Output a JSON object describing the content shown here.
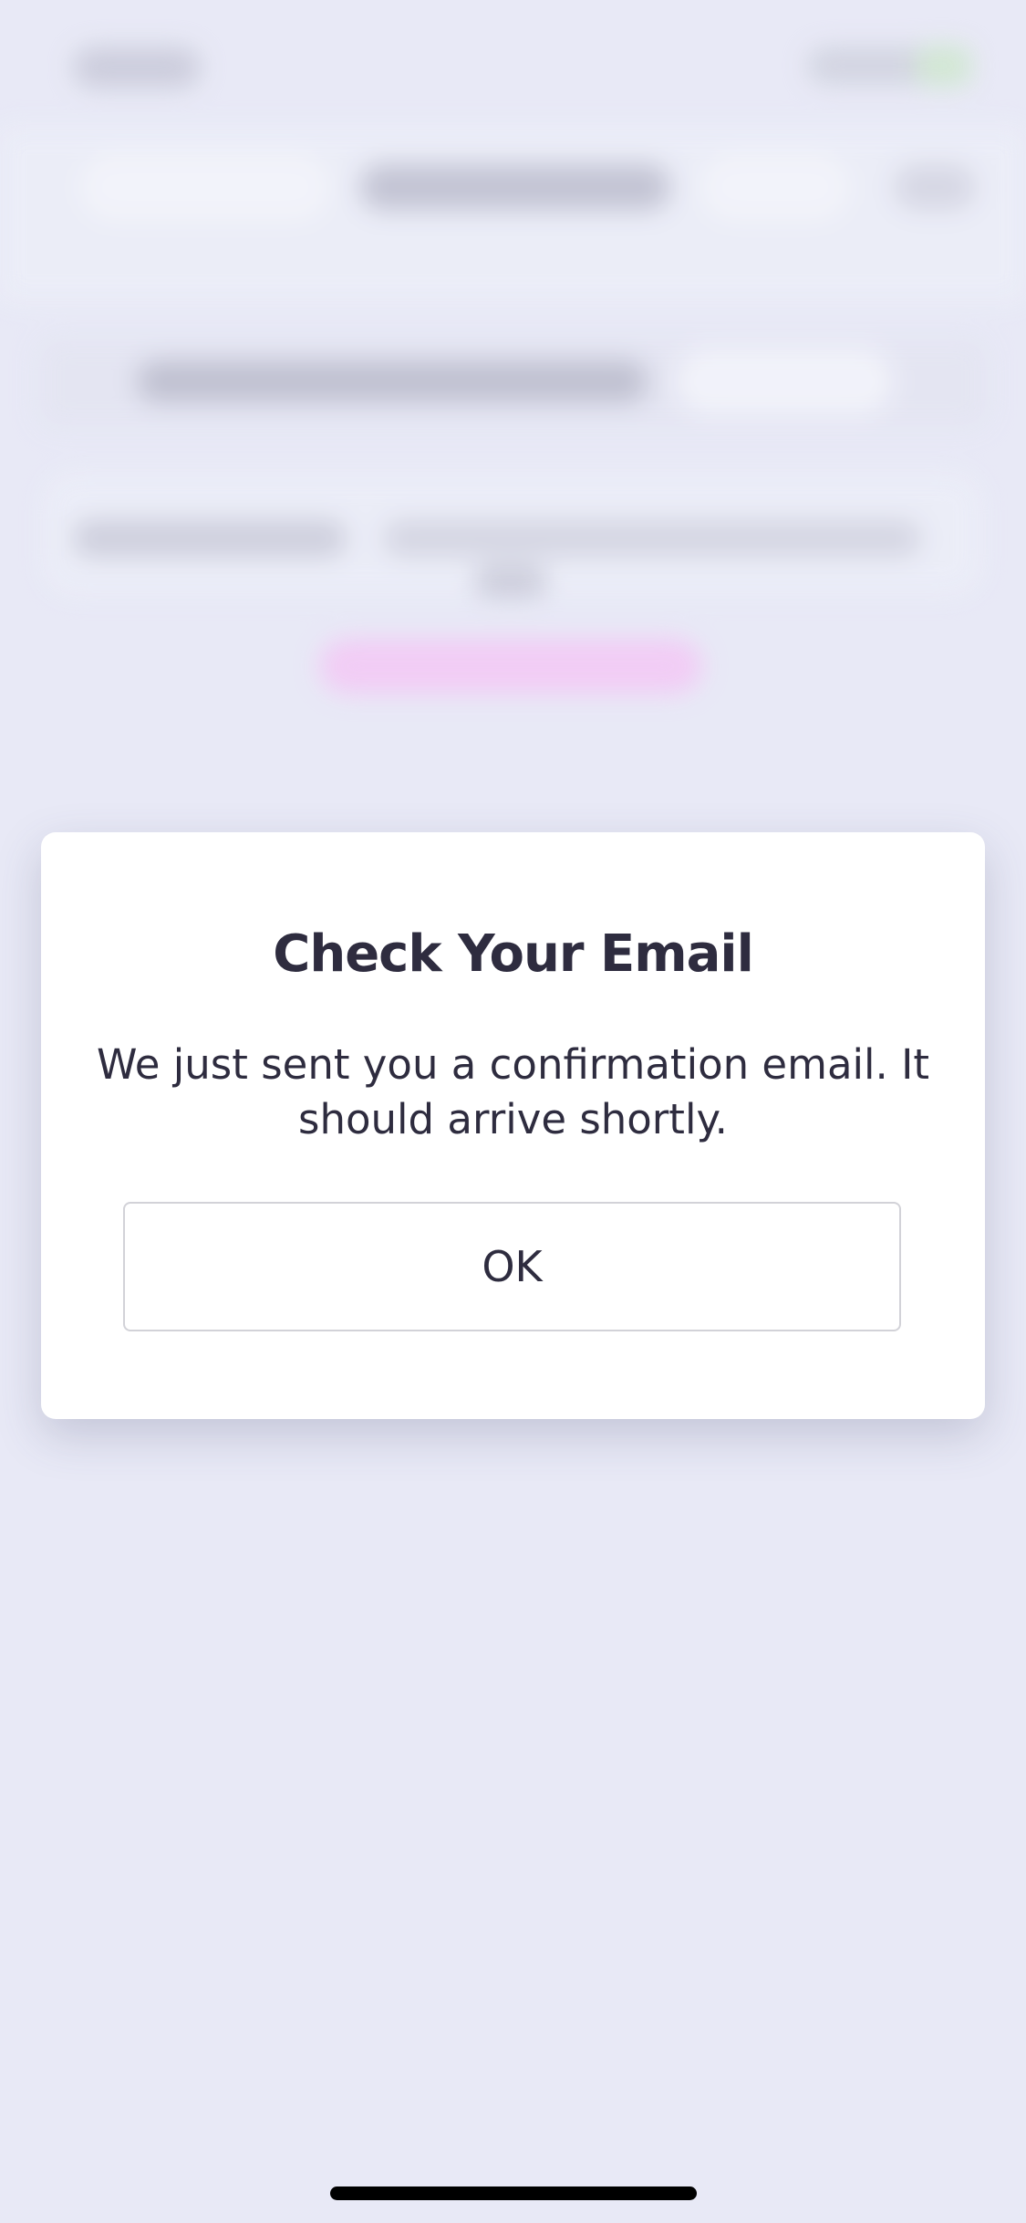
{
  "dialog": {
    "title": "Check Your Email",
    "message": "We just sent you a confirmation email. It should arrive shortly.",
    "ok_label": "OK"
  },
  "colors": {
    "backdrop": "#e8e9f6",
    "dialog_background": "#ffffff",
    "text": "#2e2c3f",
    "button_border": "#d2d2d8",
    "background_accent": "#f3c9f5"
  }
}
